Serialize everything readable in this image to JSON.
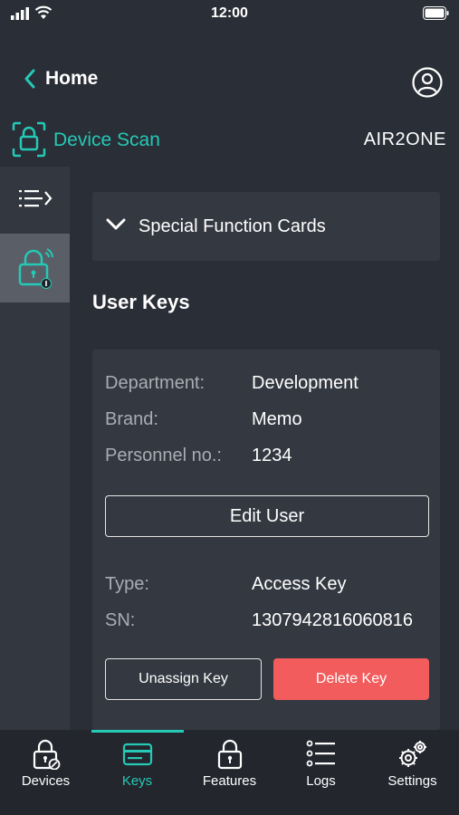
{
  "status_bar": {
    "time": "12:00"
  },
  "header": {
    "back_label": "Home",
    "scan_label": "Device Scan",
    "brand": "AIR2ONE"
  },
  "main": {
    "section_label": "Special Function Cards",
    "user_keys_title": "User Keys",
    "user_info": [
      {
        "label": "Department:",
        "value": "Development"
      },
      {
        "label": "Brand:",
        "value": "Memo"
      },
      {
        "label": "Personnel no.:",
        "value": "1234"
      }
    ],
    "edit_user_label": "Edit User",
    "key_info": [
      {
        "label": "Type:",
        "value": "Access Key"
      },
      {
        "label": "SN:",
        "value": "1307942816060816"
      }
    ],
    "unassign_label": "Unassign Key",
    "delete_label": "Delete Key"
  },
  "bottom_nav": {
    "items": [
      {
        "label": "Devices",
        "icon": "lock-settings-icon"
      },
      {
        "label": "Keys",
        "icon": "key-card-icon"
      },
      {
        "label": "Features",
        "icon": "lock-features-icon"
      },
      {
        "label": "Logs",
        "icon": "list-icon"
      },
      {
        "label": "Settings",
        "icon": "gears-icon"
      }
    ],
    "active_index": 1
  },
  "colors": {
    "accent": "#25c9b6",
    "danger": "#f25c5c",
    "background": "#2a2e36",
    "card": "#343841"
  }
}
